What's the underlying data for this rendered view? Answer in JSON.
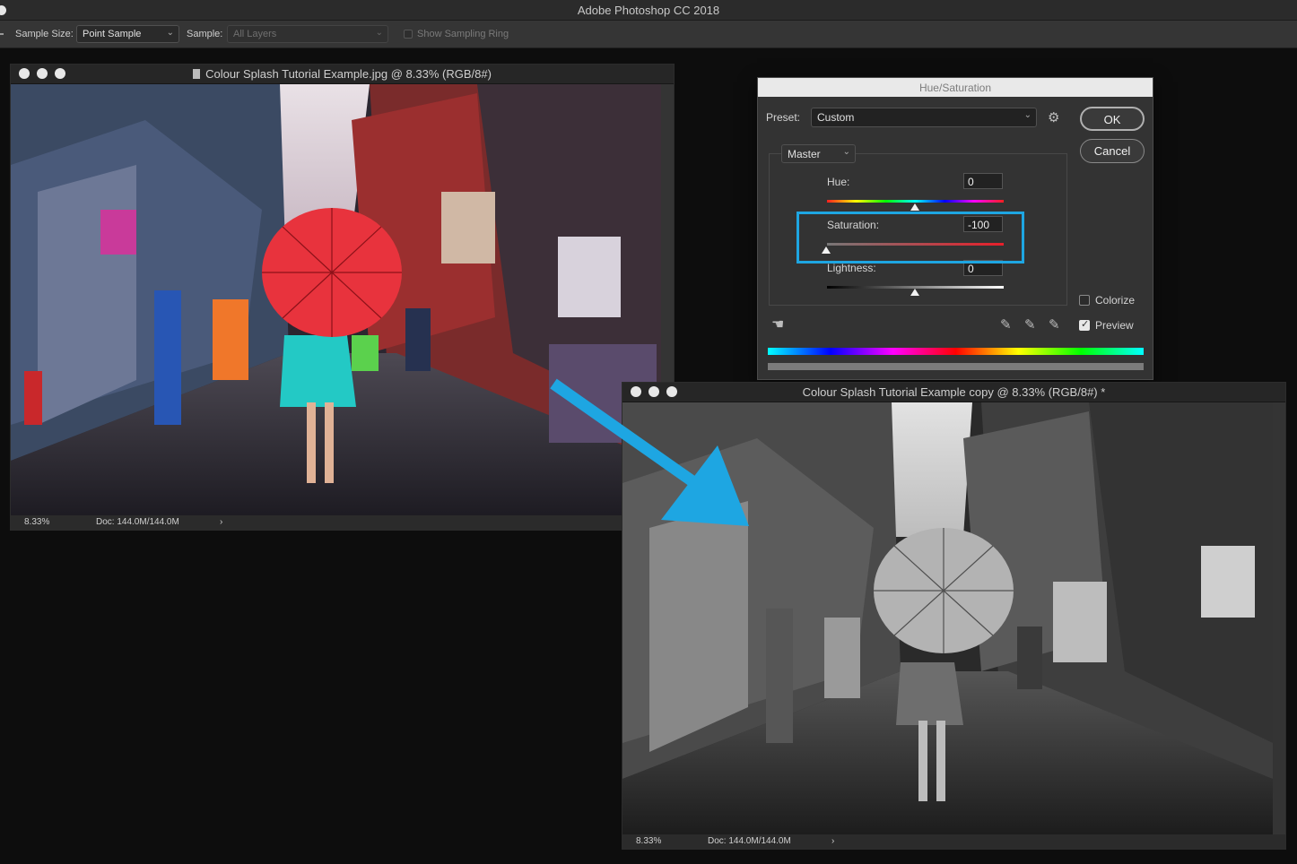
{
  "app": {
    "title": "Adobe Photoshop CC 2018"
  },
  "options_bar": {
    "sample_size_label": "Sample Size:",
    "sample_size_value": "Point Sample",
    "sample_label": "Sample:",
    "sample_value": "All Layers",
    "show_sampling_ring_label": "Show Sampling Ring"
  },
  "doc_original": {
    "title": "Colour Splash Tutorial Example.jpg @ 8.33% (RGB/8#)",
    "zoom": "8.33%",
    "doc_size": "Doc: 144.0M/144.0M",
    "status_arrow": "›"
  },
  "doc_copy": {
    "title": "Colour Splash Tutorial Example copy @ 8.33% (RGB/8#) *",
    "zoom": "8.33%",
    "doc_size": "Doc: 144.0M/144.0M",
    "status_arrow": "›"
  },
  "hue_saturation": {
    "title": "Hue/Saturation",
    "preset_label": "Preset:",
    "preset_value": "Custom",
    "channel_value": "Master",
    "ok_label": "OK",
    "cancel_label": "Cancel",
    "hue_label": "Hue:",
    "hue_value": "0",
    "saturation_label": "Saturation:",
    "saturation_value": "-100",
    "lightness_label": "Lightness:",
    "lightness_value": "0",
    "colorize_label": "Colorize",
    "colorize_checked": false,
    "preview_label": "Preview",
    "preview_checked": true
  },
  "icons": {
    "gear": "gear-icon",
    "hand": "targeted-adjustment-hand-icon",
    "eyedropper": "eyedropper-icon",
    "eyedropper_plus": "eyedropper-add-icon",
    "eyedropper_minus": "eyedropper-subtract-icon",
    "chevron": "chevron-down-icon"
  },
  "colors": {
    "highlight": "#1ea6e2",
    "arrow": "#1ea6e2",
    "umbrella": "#e8333d"
  }
}
